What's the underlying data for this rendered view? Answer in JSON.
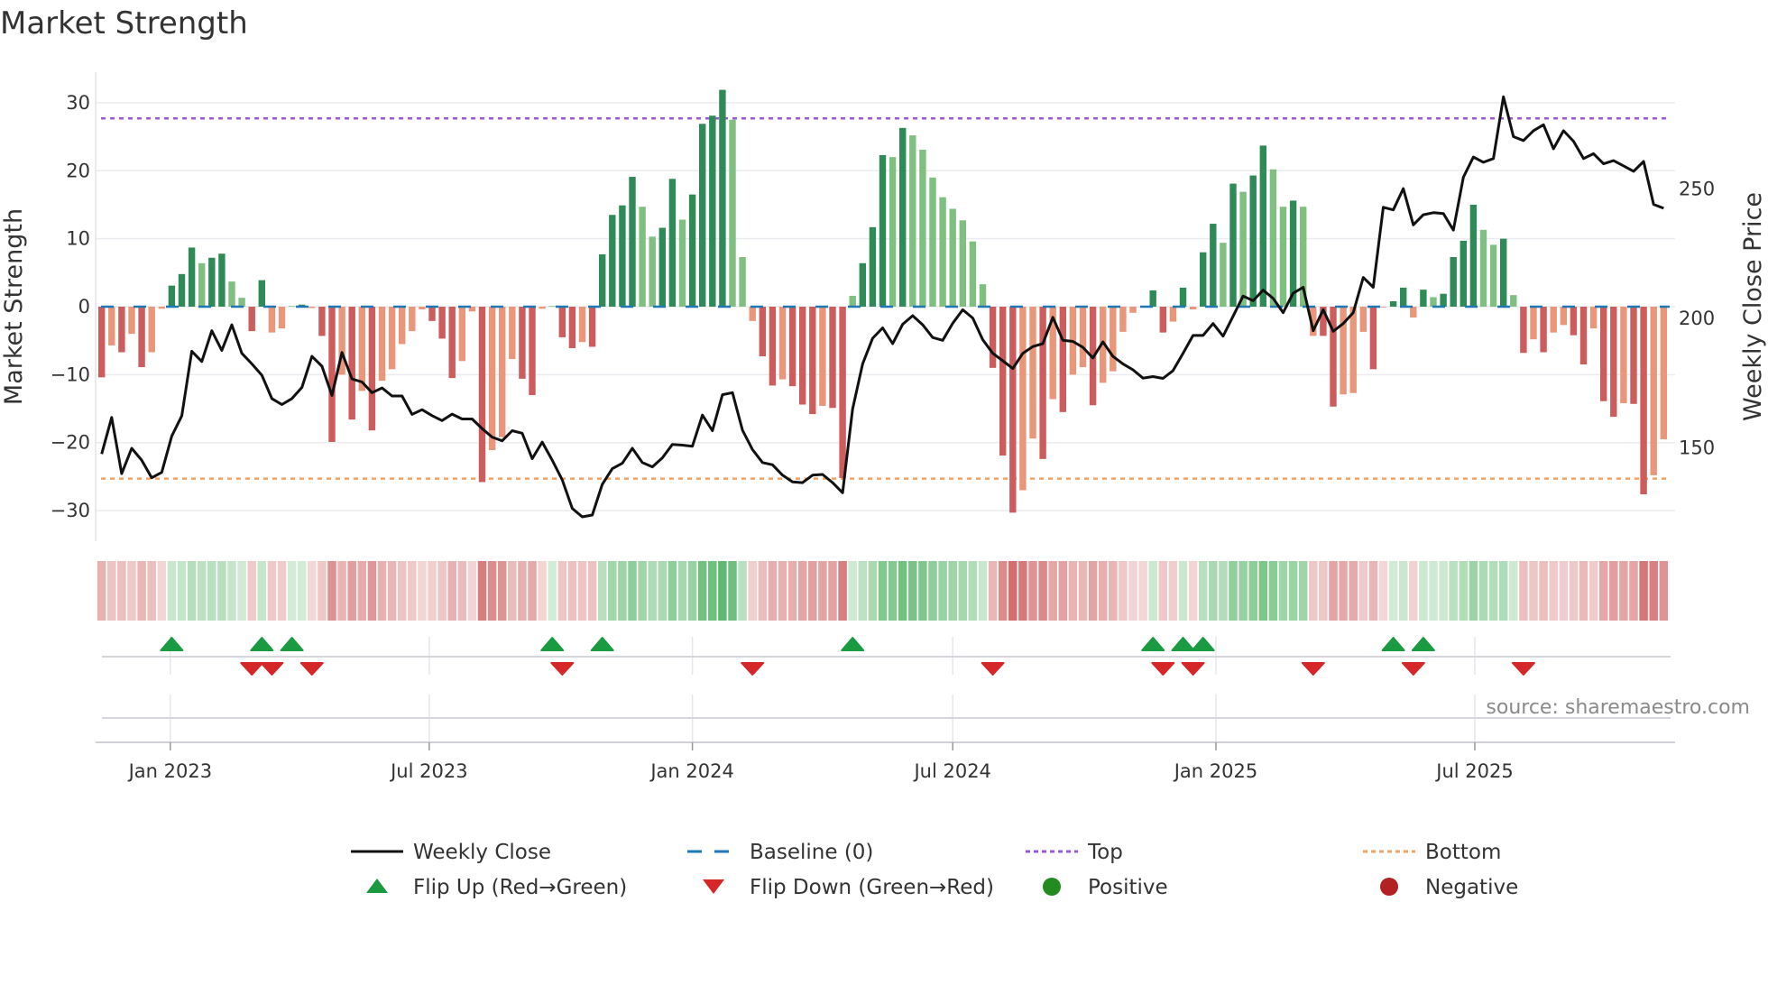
{
  "title": "Market Strength",
  "source": "source: sharemaestro.com",
  "chart_data": {
    "type": "bar+line",
    "title": "Market Strength",
    "ylabel": "Market Strength",
    "y2label": "Weekly Close Price",
    "ylim": [
      -34.5,
      34.5
    ],
    "y2lim": [
      113.6,
      294.8
    ],
    "yticks": [
      30,
      20,
      10,
      0,
      -10,
      -20,
      -30
    ],
    "ytick_labels": [
      "30",
      "20",
      "10",
      "0",
      "−10",
      "−20",
      "−30"
    ],
    "y2ticks": [
      150,
      200,
      250
    ],
    "y2tick_labels": [
      "150",
      "200",
      "250"
    ],
    "start_week": "2022-11-14",
    "xticks": [
      {
        "date": "2023-01-01",
        "label": "Jan 2023"
      },
      {
        "date": "2023-07-01",
        "label": "Jul 2023"
      },
      {
        "date": "2024-01-01",
        "label": "Jan 2024"
      },
      {
        "date": "2024-07-01",
        "label": "Jul 2024"
      },
      {
        "date": "2025-01-01",
        "label": "Jan 2025"
      },
      {
        "date": "2025-07-01",
        "label": "Jul 2025"
      }
    ],
    "top_level": 27.7,
    "bottom_level": -25.3,
    "baseline": 0,
    "strength": [
      -10.4,
      -5.7,
      -6.7,
      -4,
      -8.9,
      -6.7,
      -0.3,
      3.1,
      4.8,
      8.7,
      6.4,
      7.2,
      7.8,
      3.7,
      1.3,
      -3.6,
      3.9,
      -3.8,
      -3.2,
      0.1,
      0.3,
      -0.2,
      -4.3,
      -19.9,
      -10,
      -16.6,
      -12.4,
      -18.2,
      -10.9,
      -9.2,
      -5.5,
      -3.6,
      -0.4,
      -2.1,
      -4.7,
      -10.5,
      -8,
      -0.7,
      -25.8,
      -21.1,
      -19.2,
      -7.7,
      -10.6,
      -13,
      -0.3,
      0.1,
      -4.5,
      -6.1,
      -5.2,
      -5.9,
      7.7,
      13.5,
      14.9,
      19.1,
      14.7,
      10.3,
      11.6,
      18.8,
      12.8,
      16.5,
      26.9,
      28.1,
      31.9,
      27.5,
      7.3,
      -2.1,
      -7.3,
      -11.6,
      -10.7,
      -11.7,
      -14.4,
      -15.8,
      -14.6,
      -14.9,
      -25.2,
      1.6,
      6.4,
      11.7,
      22.3,
      22,
      26.3,
      25.2,
      23.1,
      19,
      16.1,
      14.4,
      12.7,
      9.6,
      3.3,
      -9,
      -21.9,
      -30.3,
      -27,
      -19.4,
      -22.4,
      -13.6,
      -15.5,
      -10,
      -8.9,
      -14.5,
      -11.2,
      -9.5,
      -3.7,
      -0.9,
      -0.1,
      2.4,
      -3.8,
      -2.2,
      2.8,
      -0.4,
      8,
      12.2,
      9.4,
      18.1,
      16.9,
      19.3,
      23.7,
      20.2,
      14.7,
      15.6,
      14.7,
      -4.3,
      -4.3,
      -14.7,
      -12.9,
      -12.7,
      -3.7,
      -9.2,
      -0.1,
      0.8,
      2.8,
      -1.6,
      2.5,
      1.4,
      1.9,
      7.3,
      9.7,
      15,
      11.3,
      9.1,
      10,
      1.7,
      -6.8,
      -4.8,
      -6.7,
      -3.8,
      -2.7,
      -4.2,
      -8.5,
      -3.2,
      -13.9,
      -16.2,
      -14.2,
      -14.3,
      -27.6,
      -24.8,
      -19.5
    ],
    "weekly_close": [
      147.3,
      161.4,
      139.7,
      149.5,
      144.9,
      138.1,
      140.2,
      154.2,
      162,
      187,
      183,
      194.9,
      187.3,
      197.2,
      186.2,
      182.1,
      177.7,
      168.7,
      166.4,
      168.7,
      173,
      185,
      181.2,
      169.9,
      186.5,
      176.3,
      175.1,
      171,
      172.8,
      169.7,
      169.7,
      162.6,
      164.4,
      162.1,
      160.2,
      162.7,
      160.8,
      160.8,
      157.1,
      153.8,
      152.4,
      156.3,
      155.3,
      145.5,
      151.9,
      144.9,
      137.3,
      126.3,
      123,
      123.7,
      135.6,
      141.6,
      143.7,
      149.5,
      144,
      142.3,
      145.8,
      151,
      150.7,
      150.3,
      162.3,
      156.3,
      170.2,
      171,
      156.5,
      149,
      144,
      143.1,
      139.1,
      136.5,
      136.2,
      139.1,
      139.4,
      136.2,
      132.3,
      164.7,
      182.1,
      192,
      196,
      189.9,
      197.4,
      200.7,
      197.2,
      192.3,
      191.2,
      197.8,
      203,
      199.8,
      191.4,
      186.2,
      183.3,
      180.3,
      186.2,
      188.8,
      189.9,
      200.1,
      191.2,
      190.8,
      188.5,
      184.4,
      190.6,
      185,
      182.1,
      179.8,
      176.6,
      177.2,
      176.5,
      179.5,
      186.2,
      193.1,
      193.1,
      197.7,
      192.8,
      200.5,
      208.3,
      206.5,
      210.6,
      207.4,
      201.9,
      209.4,
      211.7,
      194.9,
      203,
      194.7,
      197.7,
      201.9,
      215.5,
      211.7,
      242.6,
      241.6,
      249.8,
      235.8,
      239.7,
      240.5,
      240.2,
      233.8,
      254.2,
      262,
      260,
      261.4,
      285.3,
      269.9,
      268.4,
      272.2,
      274.5,
      265.2,
      272.2,
      268.1,
      261.4,
      263.3,
      259.4,
      260.6,
      258.6,
      256.5,
      260.3,
      243.7,
      242.2
    ],
    "flip_up_weeks": [
      7,
      16,
      19,
      45,
      50,
      75,
      105,
      108,
      110,
      129,
      132
    ],
    "flip_down_weeks": [
      15,
      17,
      21,
      46,
      65,
      89,
      106,
      109,
      121,
      131,
      142
    ],
    "legend_position": "bottom",
    "legend": [
      {
        "key": "close",
        "label": "Weekly Close"
      },
      {
        "key": "baseline",
        "label": "Baseline (0)"
      },
      {
        "key": "top",
        "label": "Top"
      },
      {
        "key": "bottom",
        "label": "Bottom"
      },
      {
        "key": "flip_up",
        "label": "Flip Up (Red→Green)"
      },
      {
        "key": "flip_down",
        "label": "Flip Down (Green→Red)"
      },
      {
        "key": "positive",
        "label": "Positive"
      },
      {
        "key": "negative",
        "label": "Negative"
      }
    ]
  },
  "colors": {
    "pos_strong": "#2e8b57",
    "pos_weak": "#7fbf7f",
    "neg_strong": "#cd5c5c",
    "neg_weak": "#e9967a",
    "close": "#111111",
    "baseline": "#1f77b4",
    "top": "#9b59d6",
    "bottom": "#f4a261",
    "flip_up": "#1a9a41",
    "flip_down": "#d62728",
    "positive": "#228b22",
    "negative": "#b22222"
  }
}
